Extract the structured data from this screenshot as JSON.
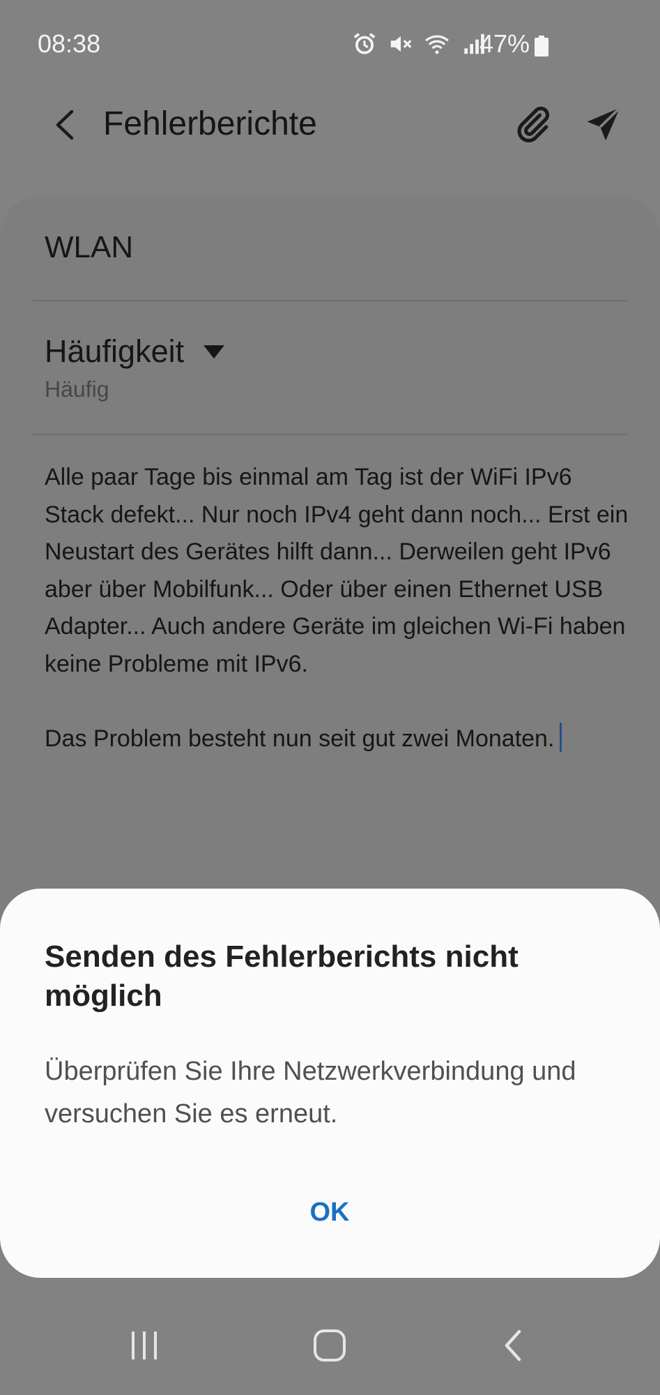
{
  "status_bar": {
    "time": "08:38",
    "battery_percent": "47%",
    "icons": [
      "alarm-icon",
      "mute-icon",
      "wifi-icon",
      "signal-icon",
      "battery-icon"
    ]
  },
  "app_bar": {
    "title": "Fehlerberichte",
    "icons": [
      "back-arrow-icon",
      "paperclip-icon",
      "send-icon"
    ]
  },
  "form": {
    "topic": "WLAN",
    "frequency_label": "Häufigkeit",
    "frequency_value": "Häufig",
    "description": "Alle paar Tage bis einmal am Tag ist der WiFi IPv6 Stack defekt... Nur noch IPv4 geht dann noch... Erst ein Neustart des Gerätes hilft dann... Derweilen geht IPv6 aber über Mobilfunk... Oder über einen Ethernet USB Adapter... Auch andere Geräte im gleichen Wi-Fi haben keine Probleme mit IPv6.\n\nDas Problem besteht nun seit gut zwei Monaten."
  },
  "dialog": {
    "title": "Senden des Fehlerberichts nicht möglich",
    "message": "Überprüfen Sie Ihre Netzwerkverbindung und versuchen Sie es erneut.",
    "ok_label": "OK"
  },
  "nav_bar": {
    "icons": [
      "recent-apps-icon",
      "home-icon",
      "back-icon"
    ]
  },
  "colors": {
    "overlay_background": "#828282",
    "dialog_background": "#fbfbfb",
    "ok_accent": "#1b6fc4"
  }
}
